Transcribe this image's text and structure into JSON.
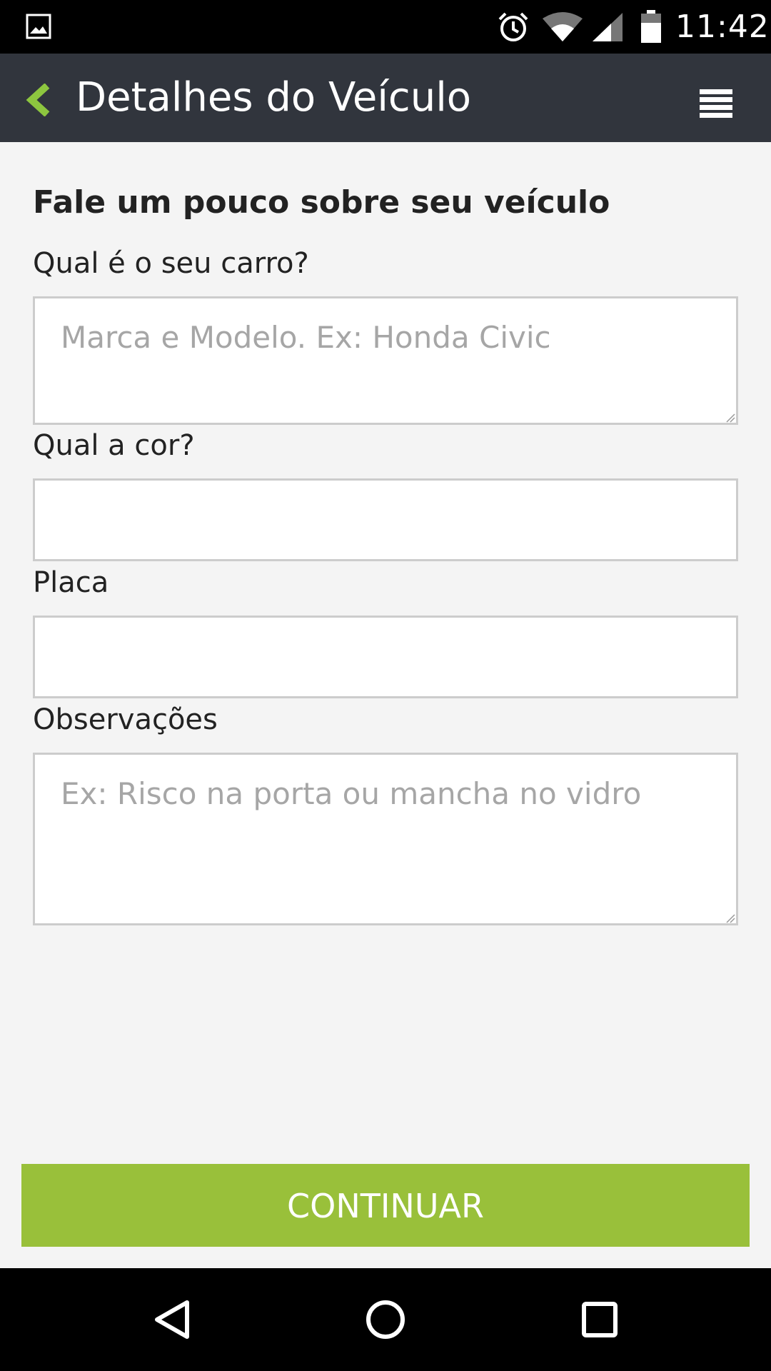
{
  "status_bar": {
    "time": "11:42",
    "icons": [
      "gallery-icon",
      "alarm-icon",
      "wifi-icon",
      "signal-icon",
      "battery-icon"
    ]
  },
  "app_bar": {
    "title": "Detalhes do Veículo",
    "back_icon": "chevron-left-icon",
    "menu_icon": "hamburger-menu-icon",
    "accent_color": "#8dc63f",
    "background_color": "#31353d"
  },
  "form": {
    "heading": "Fale um pouco sobre seu veículo",
    "fields": {
      "car": {
        "label": "Qual é o seu carro?",
        "value": "",
        "placeholder": "Marca e Modelo. Ex: Honda Civic"
      },
      "color": {
        "label": "Qual a cor?",
        "value": "",
        "placeholder": ""
      },
      "plate": {
        "label": "Placa",
        "value": "",
        "placeholder": ""
      },
      "notes": {
        "label": "Observações",
        "value": "",
        "placeholder": "Ex: Risco na porta ou mancha no vidro"
      }
    }
  },
  "continue_button": {
    "label": "CONTINUAR",
    "color": "#99c03a"
  },
  "nav_bar": {
    "icons": [
      "back-triangle-icon",
      "home-circle-icon",
      "recents-square-icon"
    ]
  }
}
